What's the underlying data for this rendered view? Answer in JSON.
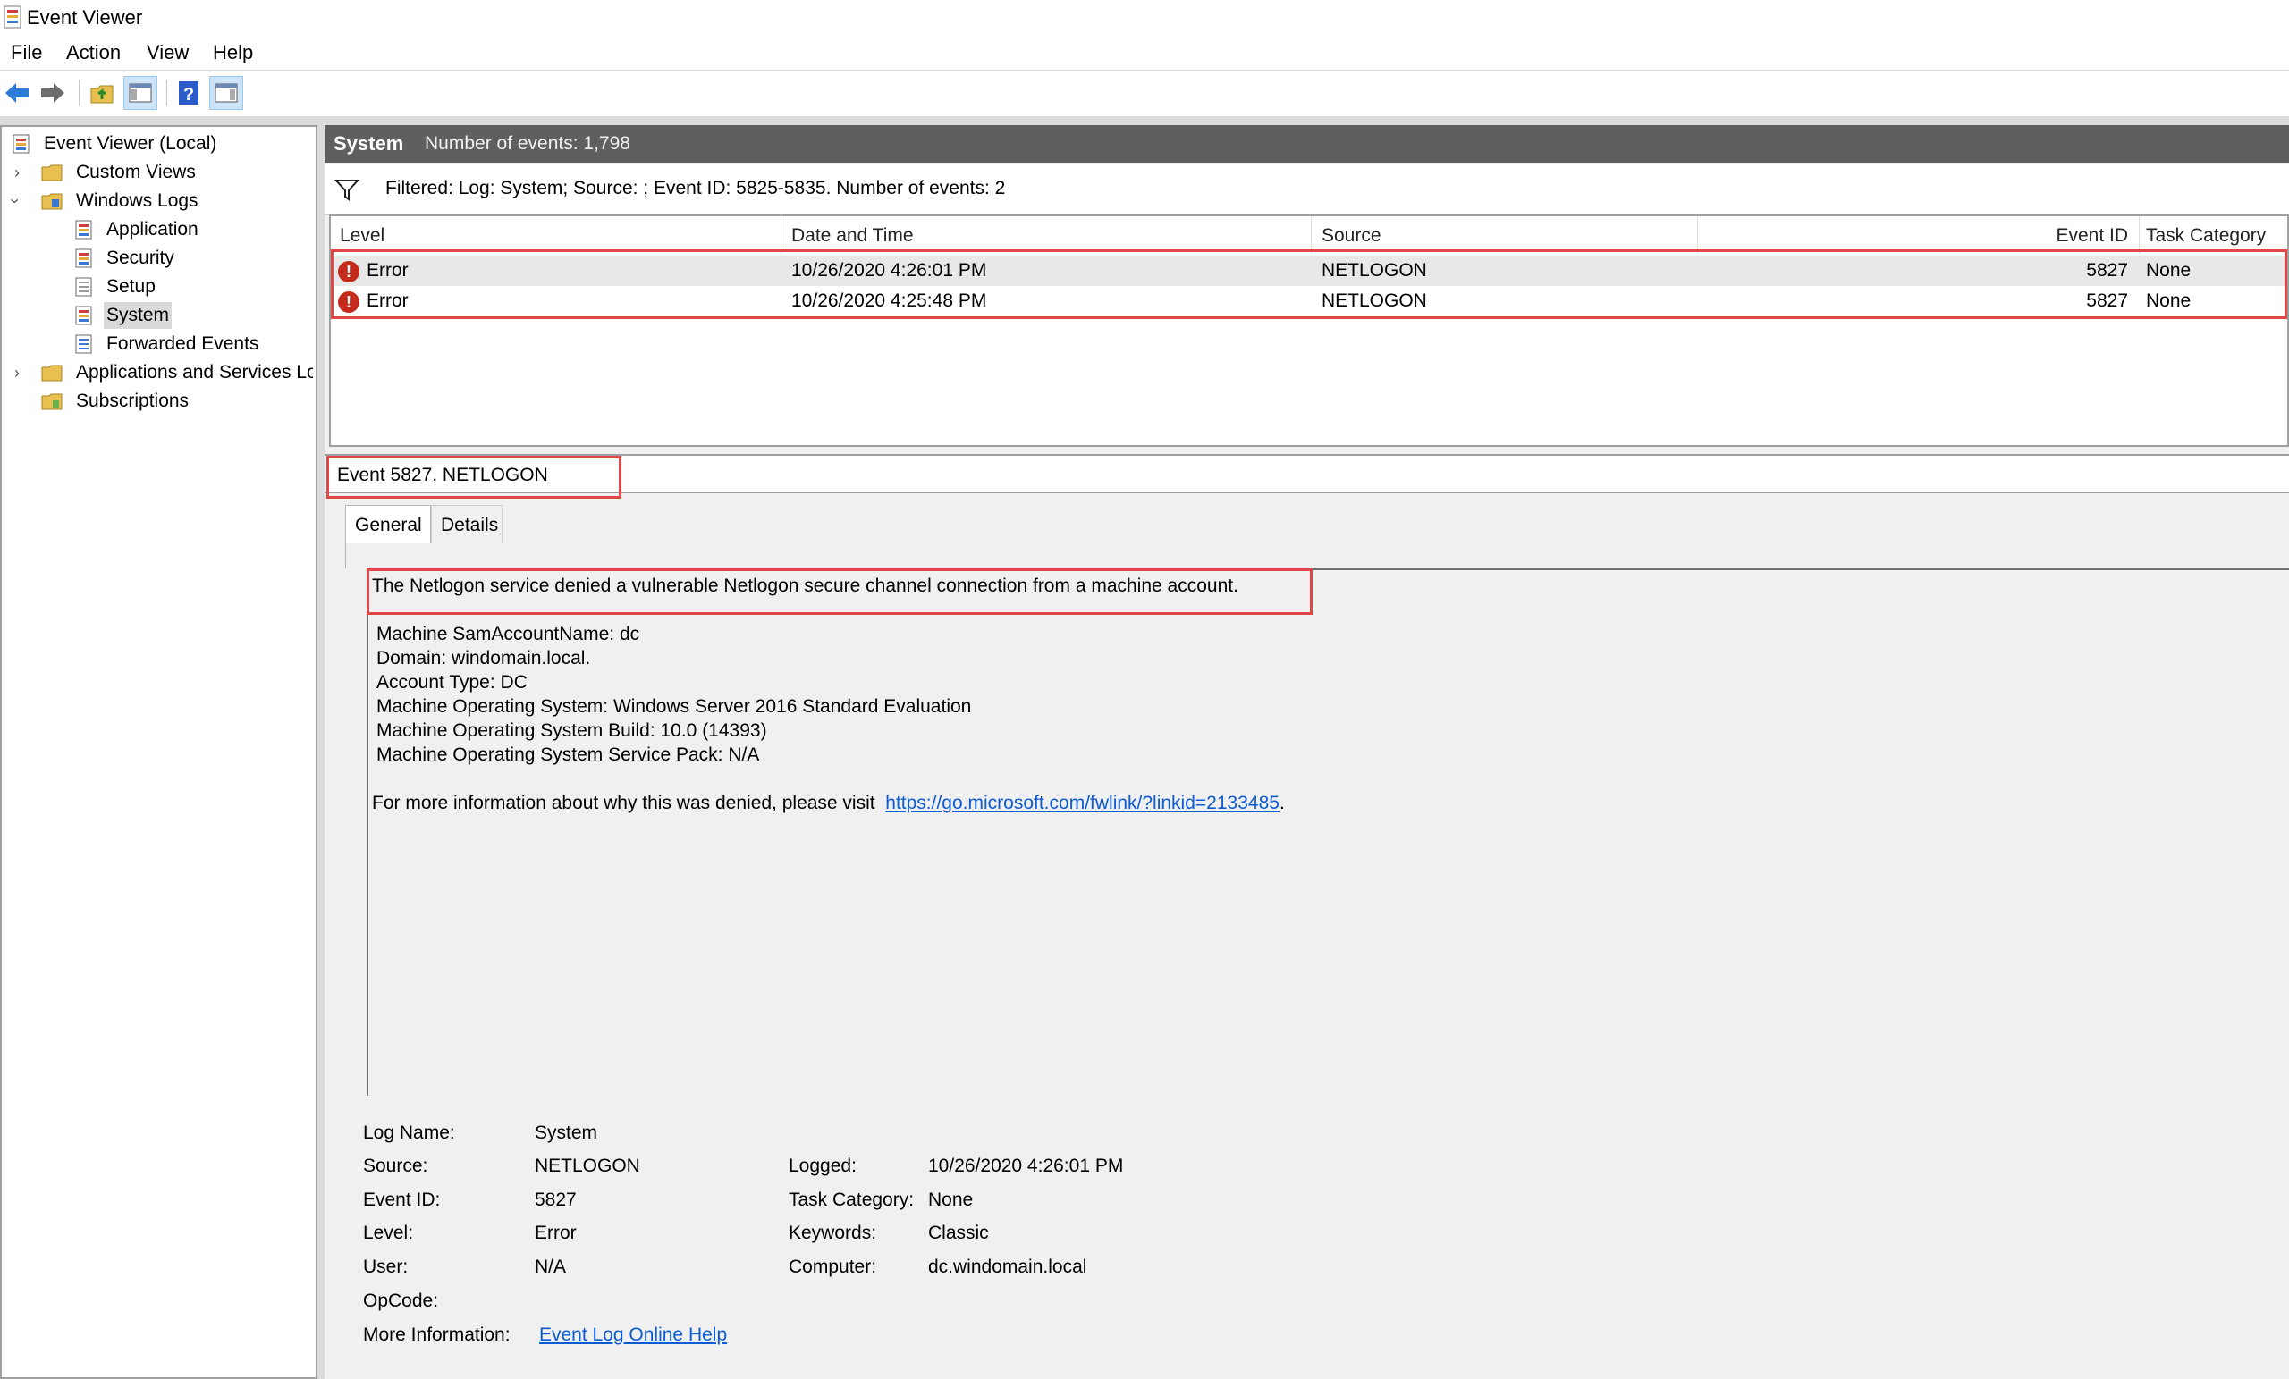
{
  "window": {
    "title": "Event Viewer"
  },
  "menu": [
    "File",
    "Action",
    "View",
    "Help"
  ],
  "tree": {
    "root": "Event Viewer (Local)",
    "custom_views": "Custom Views",
    "windows_logs": "Windows Logs",
    "application": "Application",
    "security": "Security",
    "setup": "Setup",
    "system": "System",
    "forwarded_events": "Forwarded Events",
    "apps_services": "Applications and Services Lo",
    "subscriptions": "Subscriptions"
  },
  "header": {
    "log_name": "System",
    "count_text": "Number of events: 1,798"
  },
  "filter": {
    "text": "Filtered: Log: System; Source: ; Event ID: 5825-5835. Number of events: 2"
  },
  "grid": {
    "columns": {
      "level": "Level",
      "date": "Date and Time",
      "source": "Source",
      "event_id": "Event ID",
      "task": "Task Category"
    },
    "rows": [
      {
        "level": "Error",
        "date": "10/26/2020 4:26:01 PM",
        "source": "NETLOGON",
        "event_id": "5827",
        "task": "None"
      },
      {
        "level": "Error",
        "date": "10/26/2020 4:25:48 PM",
        "source": "NETLOGON",
        "event_id": "5827",
        "task": "None"
      }
    ]
  },
  "preview": {
    "title": "Event 5827, NETLOGON",
    "tabs": {
      "general": "General",
      "details": "Details"
    },
    "message": "The Netlogon service denied a vulnerable Netlogon secure channel connection from a machine account.",
    "details": [
      "Machine SamAccountName: dc",
      "Domain: windomain.local.",
      "Account Type: DC",
      "Machine Operating System: Windows Server 2016 Standard Evaluation",
      "Machine Operating System Build: 10.0 (14393)",
      "Machine Operating System Service Pack: N/A"
    ],
    "more_info_prefix": "For more information about why this was denied, please visit",
    "more_info_link": "https://go.microsoft.com/fwlink/?linkid=2133485",
    "more_info_suffix": "."
  },
  "fields": {
    "log_name_label": "Log Name:",
    "log_name_value": "System",
    "source_label": "Source:",
    "source_value": "NETLOGON",
    "event_id_label": "Event ID:",
    "event_id_value": "5827",
    "level_label": "Level:",
    "level_value": "Error",
    "user_label": "User:",
    "user_value": "N/A",
    "opcode_label": "OpCode:",
    "more_info_label": "More Information:",
    "more_info_value": "Event Log Online Help",
    "logged_label": "Logged:",
    "logged_value": "10/26/2020 4:26:01 PM",
    "task_category_label": "Task Category:",
    "task_category_value": "None",
    "keywords_label": "Keywords:",
    "keywords_value": "Classic",
    "computer_label": "Computer:",
    "computer_value": "dc.windomain.local"
  },
  "colors": {
    "header_bg": "#5f5f5f",
    "highlight_border": "#e04848",
    "error": "#c42b1c",
    "link": "#0b5bd3"
  },
  "icons": [
    "event-viewer-icon",
    "back-arrow-icon",
    "forward-arrow-icon",
    "folder-up-icon",
    "show-hide-tree-icon",
    "help-icon",
    "show-hide-action-pane-icon",
    "filter-icon",
    "error-icon",
    "log-icon",
    "folder-icon"
  ]
}
